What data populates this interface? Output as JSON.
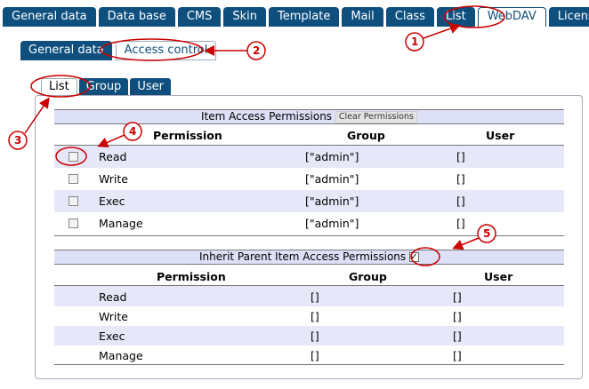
{
  "top_tabs": [
    "General data",
    "Data base",
    "CMS",
    "Skin",
    "Template",
    "Mail",
    "Class",
    "List",
    "WebDAV",
    "License"
  ],
  "sub_tabs": [
    "General data",
    "Access control"
  ],
  "third_tabs": [
    "List",
    "Group",
    "User"
  ],
  "item_perm": {
    "title": "Item Access Permissions",
    "clear_button": "Clear Permissions",
    "col_permission": "Permission",
    "col_group": "Group",
    "col_user": "User",
    "rows": [
      {
        "perm": "Read",
        "group": "[\"admin\"]",
        "user": "[]"
      },
      {
        "perm": "Write",
        "group": "[\"admin\"]",
        "user": "[]"
      },
      {
        "perm": "Exec",
        "group": "[\"admin\"]",
        "user": "[]"
      },
      {
        "perm": "Manage",
        "group": "[\"admin\"]",
        "user": "[]"
      }
    ]
  },
  "inherit": {
    "title": "Inherit Parent Item Access Permissions",
    "check_mark": "✓",
    "col_permission": "Permission",
    "col_group": "Group",
    "col_user": "User",
    "rows": [
      {
        "perm": "Read",
        "group": "[]",
        "user": "[]"
      },
      {
        "perm": "Write",
        "group": "[]",
        "user": "[]"
      },
      {
        "perm": "Exec",
        "group": "[]",
        "user": "[]"
      },
      {
        "perm": "Manage",
        "group": "[]",
        "user": "[]"
      }
    ]
  },
  "callouts": [
    "1",
    "2",
    "3",
    "4",
    "5"
  ],
  "colors": {
    "tab_blue": "#0e4f7e",
    "header_bg": "#dde0f7",
    "row_shade": "#e6e8f9",
    "callout_red": "#cc0000"
  }
}
